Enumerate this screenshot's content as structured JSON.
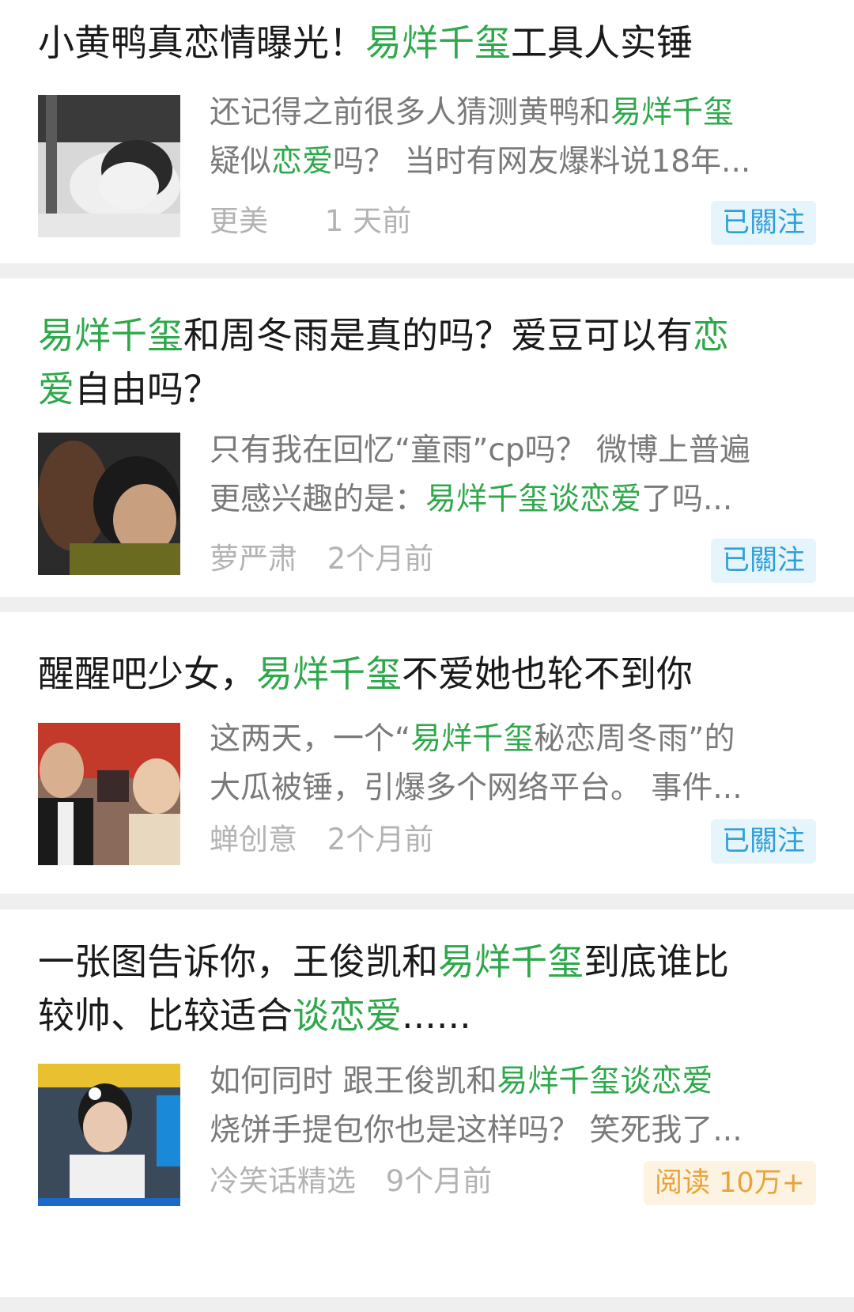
{
  "colors": {
    "highlight": "#2fa84b",
    "follow_badge": "#2f9fd8",
    "reads_badge": "#e8a33a"
  },
  "articles": [
    {
      "title": [
        {
          "t": "小黄鸭真恋情曝光！",
          "hl": false
        },
        {
          "t": "易烊千玺",
          "hl": true
        },
        {
          "t": "工具人实锤",
          "hl": false
        }
      ],
      "snippet_line1": [
        {
          "t": "还记得之前很多人猜测黄鸭和",
          "hl": false
        },
        {
          "t": "易烊千玺",
          "hl": true
        }
      ],
      "snippet_line2": [
        {
          "t": "疑似",
          "hl": false
        },
        {
          "t": "恋爱",
          "hl": true
        },
        {
          "t": "吗？ 当时有网友爆料说18年...",
          "hl": false
        }
      ],
      "source": "更美",
      "time": "1 天前",
      "badge": "已關注",
      "badge_type": "follow",
      "thumb_icon": "photo-thumbnail"
    },
    {
      "title": [
        {
          "t": "易烊千玺",
          "hl": true
        },
        {
          "t": "和周冬雨是真的吗？爱豆可以有",
          "hl": false
        },
        {
          "t": "恋",
          "hl": true
        },
        {
          "t": "\n",
          "hl": false
        },
        {
          "t": "爱",
          "hl": true
        },
        {
          "t": "自由吗？",
          "hl": false
        }
      ],
      "snippet_line1": [
        {
          "t": "只有我在回忆“童雨”cp吗？ 微博上普遍",
          "hl": false
        }
      ],
      "snippet_line2": [
        {
          "t": "更感兴趣的是：",
          "hl": false
        },
        {
          "t": "易烊千玺谈恋爱",
          "hl": true
        },
        {
          "t": "了吗...",
          "hl": false
        }
      ],
      "source": "萝严肃",
      "time": "2个月前",
      "badge": "已關注",
      "badge_type": "follow",
      "thumb_icon": "photo-thumbnail"
    },
    {
      "title": [
        {
          "t": "醒醒吧少女，",
          "hl": false
        },
        {
          "t": "易烊千玺",
          "hl": true
        },
        {
          "t": "不爱她也轮不到你",
          "hl": false
        }
      ],
      "snippet_line1": [
        {
          "t": "这两天，一个“",
          "hl": false
        },
        {
          "t": "易烊千玺",
          "hl": true
        },
        {
          "t": "秘恋周冬雨”的",
          "hl": false
        }
      ],
      "snippet_line2": [
        {
          "t": "大瓜被锤，引爆多个网络平台。 事件...",
          "hl": false
        }
      ],
      "source": "蝉创意",
      "time": "2个月前",
      "badge": "已關注",
      "badge_type": "follow",
      "thumb_icon": "photo-thumbnail"
    },
    {
      "title": [
        {
          "t": "一张图告诉你，王俊凯和",
          "hl": false
        },
        {
          "t": "易烊千玺",
          "hl": true
        },
        {
          "t": "到底谁比\n较帅、比较适合",
          "hl": false
        },
        {
          "t": "谈恋爱",
          "hl": true
        },
        {
          "t": "......",
          "hl": false
        }
      ],
      "snippet_line1": [
        {
          "t": "如何同时 跟王俊凯和",
          "hl": false
        },
        {
          "t": "易烊千玺谈恋爱",
          "hl": true
        }
      ],
      "snippet_line2": [
        {
          "t": "烧饼手提包你也是这样吗？ 笑死我了...",
          "hl": false
        }
      ],
      "source": "冷笑话精选",
      "time": "9个月前",
      "badge": "阅读 10万+",
      "badge_type": "reads",
      "thumb_icon": "photo-thumbnail"
    }
  ]
}
